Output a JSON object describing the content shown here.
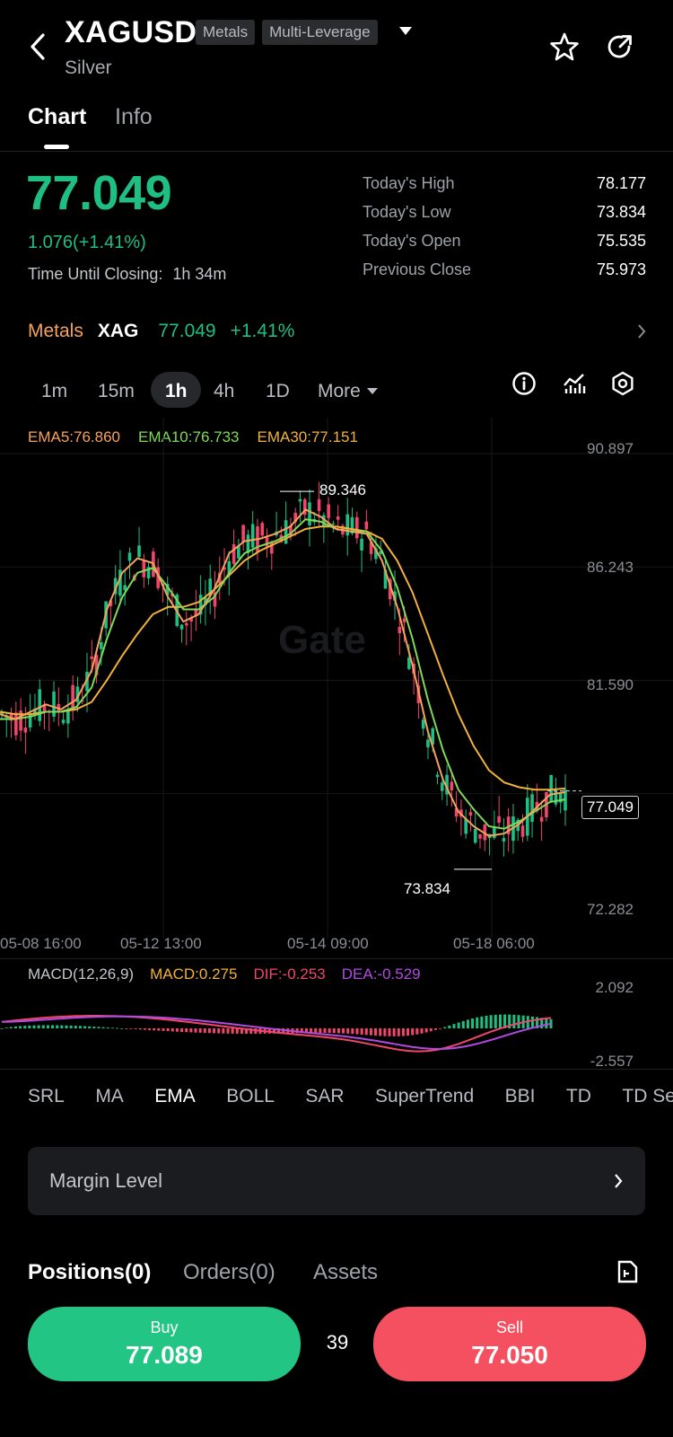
{
  "header": {
    "symbol": "XAGUSD",
    "name": "Silver",
    "tags": [
      "Metals",
      "Multi-Leverage"
    ]
  },
  "tabs": [
    "Chart",
    "Info"
  ],
  "price": {
    "last": "77.049",
    "change": "1.076(+1.41%)",
    "closing_label": "Time Until Closing:",
    "closing_value": "1h 34m"
  },
  "stats": [
    {
      "label": "Today's High",
      "value": "78.177"
    },
    {
      "label": "Today's Low",
      "value": "73.834"
    },
    {
      "label": "Today's Open",
      "value": "75.535"
    },
    {
      "label": "Previous Close",
      "value": "75.973"
    }
  ],
  "ticker": {
    "category": "Metals",
    "symbol": "XAG",
    "price": "77.049",
    "change": "+1.41%"
  },
  "intervals": [
    "1m",
    "15m",
    "1h",
    "4h",
    "1D",
    "More"
  ],
  "intervals_selected": "1h",
  "ema_legend": {
    "ema5": "EMA5:76.860",
    "ema10": "EMA10:76.733",
    "ema30": "EMA30:77.151"
  },
  "chart_data": {
    "type": "candlestick",
    "y_ticks": [
      "90.897",
      "86.243",
      "81.590",
      "72.282"
    ],
    "x_ticks": [
      "05-08 16:00",
      "05-12 13:00",
      "05-14 09:00",
      "05-18 06:00"
    ],
    "ylim": [
      72.282,
      90.897
    ],
    "high_marker": "89.346",
    "low_marker": "73.834",
    "last_price_label": "77.049",
    "colors": {
      "up": "#1fbf83",
      "down": "#f0466a",
      "ema5": "#f5a25d",
      "ema10": "#7fd95a",
      "ema30": "#f2b23a"
    },
    "ema5": [
      80.2,
      80.0,
      80.3,
      80.6,
      80.4,
      80.8,
      82.0,
      84.5,
      86.0,
      86.6,
      86.4,
      85.0,
      84.0,
      84.3,
      85.3,
      86.8,
      87.3,
      87.4,
      87.6,
      87.9,
      88.6,
      88.3,
      87.8,
      87.7,
      87.6,
      86.5,
      84.6,
      82.2,
      79.5,
      77.5,
      76.2,
      75.6,
      75.2,
      75.3,
      75.7,
      76.3,
      76.9,
      77.0
    ],
    "ema10": [
      80.0,
      80.0,
      80.1,
      80.3,
      80.3,
      80.5,
      81.3,
      83.3,
      85.0,
      86.0,
      86.2,
      85.4,
      84.5,
      84.5,
      85.0,
      86.0,
      86.8,
      87.1,
      87.3,
      87.6,
      88.2,
      88.1,
      87.8,
      87.7,
      87.7,
      86.9,
      85.4,
      83.3,
      80.8,
      78.7,
      77.1,
      76.3,
      75.6,
      75.5,
      75.8,
      76.2,
      76.6,
      76.7
    ],
    "ema30": [
      80.3,
      80.2,
      80.2,
      80.3,
      80.3,
      80.4,
      80.7,
      81.6,
      82.6,
      83.5,
      84.3,
      84.6,
      84.6,
      84.8,
      85.3,
      85.9,
      86.5,
      86.9,
      87.2,
      87.5,
      87.8,
      87.9,
      87.9,
      87.8,
      87.7,
      87.4,
      86.5,
      85.2,
      83.5,
      81.8,
      80.2,
      78.9,
      77.9,
      77.4,
      77.2,
      77.1,
      77.1,
      77.15
    ],
    "macd_legend": {
      "title": "MACD(12,26,9)",
      "macd": "MACD:0.275",
      "dif": "DIF:-0.253",
      "dea": "DEA:-0.529"
    },
    "macd_ticks": [
      "2.092",
      "-2.557"
    ]
  },
  "indicators": [
    "SRL",
    "MA",
    "EMA",
    "BOLL",
    "SAR",
    "SuperTrend",
    "BBI",
    "TD",
    "TD Se"
  ],
  "indicator_selected": "EMA",
  "margin": {
    "label": "Margin Level"
  },
  "bottom_tabs": [
    "Positions(0)",
    "Orders(0)",
    "Assets"
  ],
  "trade": {
    "buy_label": "Buy",
    "buy_price": "77.089",
    "spread": "39",
    "sell_label": "Sell",
    "sell_price": "77.050"
  }
}
